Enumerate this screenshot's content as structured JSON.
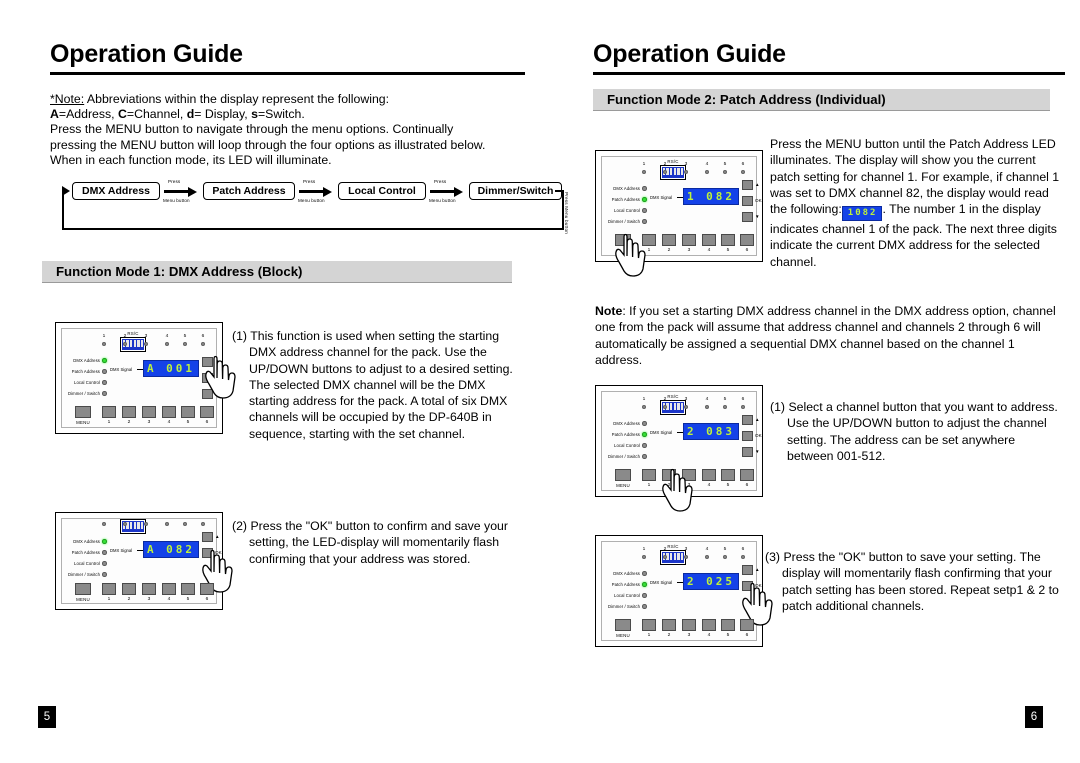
{
  "left_page": {
    "title": "Operation Guide",
    "page_number": "5",
    "note": {
      "label": "*Note:",
      "line1_rest": " Abbreviations within the display represent the following:",
      "abbrev_a": "A",
      "abbrev_a_rest": "=Address, ",
      "abbrev_c": "C",
      "abbrev_c_rest": "=Channel, ",
      "abbrev_d": "d",
      "abbrev_d_rest": "= Display, ",
      "abbrev_s": "s",
      "abbrev_s_rest": "=Switch.",
      "line3": "Press the MENU button to navigate through the menu options. Continually",
      "line4": "pressing the MENU button will loop through the four options as illustrated below.",
      "line5": "When in each function mode, its LED will illuminate."
    },
    "flow": {
      "boxes": [
        {
          "label": "DMX Address"
        },
        {
          "label": "Patch Address"
        },
        {
          "label": "Local Control"
        },
        {
          "label": "Dimmer/Switch"
        }
      ],
      "arrow_label_top": "Press",
      "arrow_label_bottom": "Menu button",
      "loop_label": "Press Menu button"
    },
    "mode_bar": "Function Mode 1:  DMX Address (Block)",
    "step1": {
      "text": "(1) This function is used when setting the starting DMX address channel for the pack. Use the UP/DOWN buttons to adjust to a desired setting. The selected DMX channel will be the DMX starting address for the pack. A total of six DMX channels will be occupied by the DP-640B in sequence, starting with the set channel."
    },
    "step2": {
      "text": "(2) Press the \"OK\" button to confirm and save your setting, the LED-display will momentarily flash confirming that your address was stored."
    },
    "panel1": {
      "display_value": "A 001",
      "active_mode_index": 0,
      "hand_target": "up-button"
    },
    "panel2": {
      "display_value": "A 082",
      "active_mode_index": 0,
      "hand_target": "ok-button"
    }
  },
  "right_page": {
    "title": "Operation Guide",
    "page_number": "6",
    "mode_bar": "Function Mode 2:  Patch Address (Individual)",
    "intro": {
      "part1": "Press the MENU button until the Patch Address LED illuminates. The display will show you the current patch setting for channel 1. For example, if channel 1 was set to DMX channel 82, the display would read the following:",
      "inline_display": "1082",
      "part2": ". The number 1 in the display indicates channel 1 of the pack. The next three digits indicate the current DMX address for the selected channel."
    },
    "note": {
      "label": "Note",
      "text": ": If you set a starting DMX address channel in the DMX address option, channel one from the pack will assume that address channel and channels 2 through 6 will automatically be assigned a sequential DMX channel based on the channel 1 address."
    },
    "step1": {
      "text": "(1) Select a channel button that you want to address. Use the UP/DOWN button to adjust the channel setting. The address can be set anywhere between 001-512."
    },
    "step3": {
      "text": "(3) Press the \"OK\" button to save your setting. The display will momentarily flash confirming that your patch setting has been stored. Repeat setp1 & 2 to patch additional channels."
    },
    "panel1": {
      "display_value": "1 082",
      "active_mode_index": 1,
      "hand_target": "menu-button"
    },
    "panel2": {
      "display_value": "2 083",
      "active_mode_index": 1,
      "hand_target": "channel-2-button"
    },
    "panel3": {
      "display_value": "2 025",
      "active_mode_index": 1,
      "hand_target": "ok-button"
    }
  },
  "panel_common": {
    "dip_caption": "RS/C",
    "channel_numbers": [
      "1",
      "2",
      "3",
      "4",
      "5",
      "6"
    ],
    "mode_labels": [
      "DMX Address",
      "Patch Address",
      "Local Control",
      "Dimmer / Switch"
    ],
    "dmx_signal_label": "DMX Signal",
    "up_label": "▲",
    "ok_label": "OK",
    "down_label": "▼",
    "menu_label": "MENU",
    "bottom_numbers": [
      "1",
      "2",
      "3",
      "4",
      "5",
      "6"
    ]
  },
  "colors": {
    "lcd_background": "#1442e8",
    "lcd_text": "#bff23a",
    "led_on": "#35e035",
    "led_off": "#8d8d8d",
    "mode_bar_background": "#d4d4d4"
  }
}
